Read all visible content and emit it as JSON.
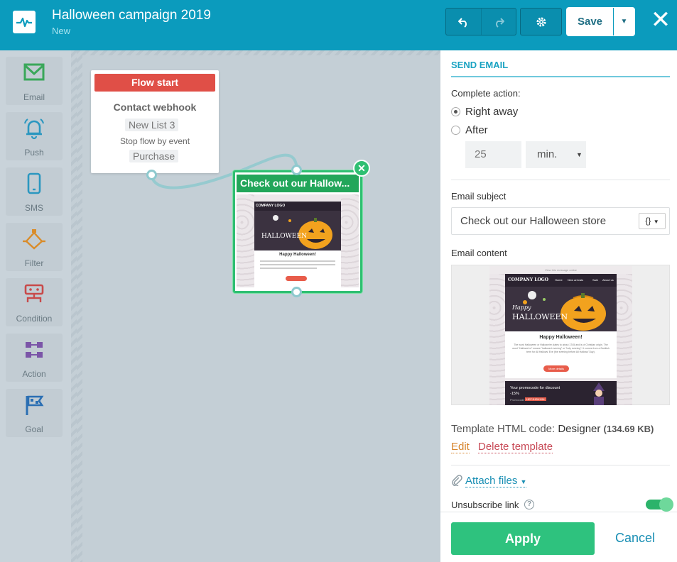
{
  "header": {
    "title": "Halloween campaign 2019",
    "status": "New",
    "save_label": "Save"
  },
  "tools": [
    {
      "label": "Email",
      "icon": "email-icon",
      "color": "#3aa75a"
    },
    {
      "label": "Push",
      "icon": "bell-icon",
      "color": "#2b97c0"
    },
    {
      "label": "SMS",
      "icon": "phone-icon",
      "color": "#2b97c0"
    },
    {
      "label": "Filter",
      "icon": "filter-icon",
      "color": "#d98c2a"
    },
    {
      "label": "Condition",
      "icon": "condition-icon",
      "color": "#c84a4a"
    },
    {
      "label": "Action",
      "icon": "action-icon",
      "color": "#7b55a8"
    },
    {
      "label": "Goal",
      "icon": "flag-icon",
      "color": "#2b6fb3"
    }
  ],
  "canvas": {
    "start_card": {
      "header": "Flow start",
      "title": "Contact webhook",
      "list": "New List 3",
      "stop_text": "Stop flow by event",
      "event": "Purchase"
    },
    "email_card": {
      "title": "Check out our Hallow..."
    }
  },
  "email_thumb": {
    "top_line": "View this message online",
    "logo": "COMPANY LOGO",
    "nav": [
      "Home",
      "New arrivals",
      "Sale",
      "About us"
    ],
    "hero_text": "HAPPY HALLOWEEN",
    "heading": "Happy Halloween!",
    "body": "The word Halloween or Hallowe'en dates to about 1745 and is of Christian origin. The word \"Hallowe'en\" means \"hallowed evening\" or \"holy evening\". It comes from a Scottish term for All Hallows' Eve (the evening before All Hallows' Day).",
    "button": "More details",
    "promo": "Your promocode for discount -15%",
    "promo_label": "Promocode",
    "promo_code": "HEFJHSHX94"
  },
  "panel": {
    "section_title": "SEND EMAIL",
    "complete_label": "Complete action:",
    "radio_right_away": "Right away",
    "radio_after": "After",
    "after_value": "25",
    "after_unit": "min.",
    "subject_label": "Email subject",
    "subject_value": "Check out our Halloween store",
    "var_button": "{}",
    "content_label": "Email content",
    "template_label": "Template HTML code:",
    "template_name": "Designer",
    "template_size": "(134.69 KB)",
    "edit_link": "Edit",
    "delete_link": "Delete template",
    "attach_label": "Attach files",
    "unsubscribe_label": "Unsubscribe link",
    "apply_label": "Apply",
    "cancel_label": "Cancel"
  }
}
